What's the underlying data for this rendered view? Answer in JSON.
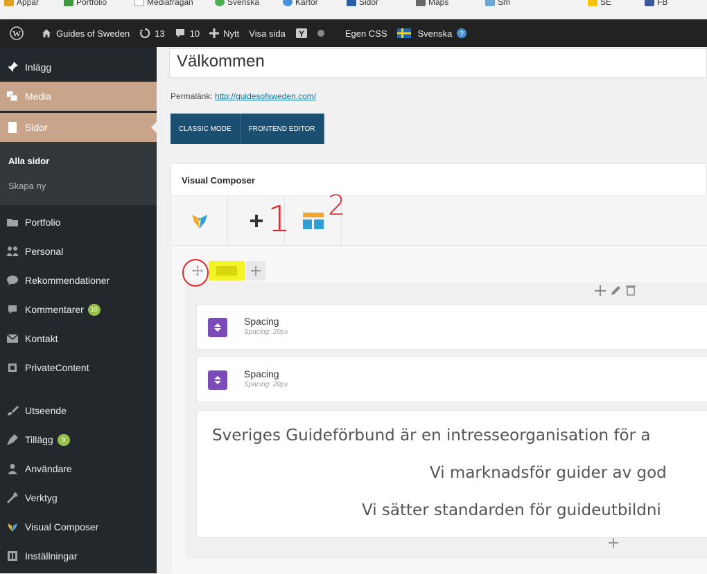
{
  "bookmarks": [
    "Appar",
    "Portfolio",
    "Mediafrågan",
    "Svenska",
    "Kartor",
    "Sidor",
    "Maps",
    "Sm",
    "SE",
    "FB"
  ],
  "adminbar": {
    "site_name": "Guides of Sweden",
    "updates": "13",
    "comments": "10",
    "new_label": "Nytt",
    "view_label": "Visa sida",
    "css_label": "Egen CSS",
    "lang_label": "Svenska"
  },
  "sidebar": {
    "items": [
      {
        "label": "Inlägg",
        "icon": "pin-icon"
      },
      {
        "label": "Media",
        "icon": "media-icon"
      },
      {
        "label": "Sidor",
        "icon": "page-icon"
      },
      {
        "label": "Portfolio",
        "icon": "folder-icon"
      },
      {
        "label": "Personal",
        "icon": "people-icon"
      },
      {
        "label": "Rekommendationer",
        "icon": "speech-icon"
      },
      {
        "label": "Kommentarer",
        "icon": "comment-icon",
        "badge": "10"
      },
      {
        "label": "Kontakt",
        "icon": "mail-icon"
      },
      {
        "label": "PrivateContent",
        "icon": "lock-icon"
      },
      {
        "label": "Utseende",
        "icon": "brush-icon"
      },
      {
        "label": "Tillägg",
        "icon": "plugin-icon",
        "badge": "9"
      },
      {
        "label": "Användare",
        "icon": "user-icon"
      },
      {
        "label": "Verktyg",
        "icon": "wrench-icon"
      },
      {
        "label": "Visual Composer",
        "icon": "vc-icon"
      },
      {
        "label": "Inställningar",
        "icon": "settings-icon"
      }
    ],
    "submenu": {
      "all_pages": "Alla sidor",
      "new_page": "Skapa ny"
    }
  },
  "editor": {
    "title_value": "Välkommen",
    "permalink_label": "Permalänk:",
    "permalink_url": "http://guidesofsweden.com/",
    "classic_mode": "CLASSIC MODE",
    "frontend_editor": "FRONTEND EDITOR"
  },
  "vc": {
    "panel_title": "Visual Composer",
    "elements": [
      {
        "name": "Spacing",
        "sub": "Spacing: 20px"
      },
      {
        "name": "Spacing",
        "sub": "Spacing: 20px"
      }
    ],
    "text_lines": [
      "Sveriges Guideförbund är en intresseorganisation för a",
      "Vi marknadsför guider av god",
      "Vi sätter standarden för guideutbildni"
    ]
  },
  "annotations": {
    "one": "1",
    "two": "2"
  },
  "colors": {
    "admin_bg": "#222222",
    "sidebar_bg": "#23282d",
    "active": "#c7a48a",
    "vc_button": "#1b4f72",
    "spacing_icon": "#7b4cb7",
    "annotation": "#e8232a"
  }
}
